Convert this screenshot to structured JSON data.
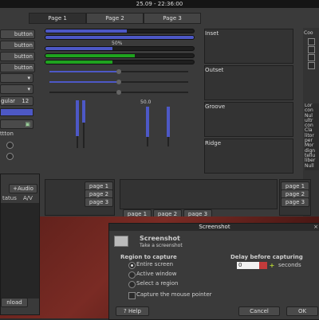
{
  "topbar": {
    "clock": "25.09 - 22:36:00"
  },
  "tabs": [
    "Page 1",
    "Page 2",
    "Page 3"
  ],
  "left_buttons": [
    "button",
    "button",
    "button",
    "button"
  ],
  "left_spin": {
    "value": "12",
    "label": "gular"
  },
  "left_text": {
    "label": "ttton"
  },
  "progress": {
    "percent_label": "50%",
    "blue_levels": [
      0.55,
      1.0,
      0.45
    ],
    "green_levels": [
      0.6,
      0.45
    ]
  },
  "frames": [
    "Inset",
    "Outset",
    "Groove",
    "Ridge"
  ],
  "scale_value": "50.0",
  "right_text": [
    "Lor",
    "con",
    "Nul",
    "ultr",
    "con",
    "Cla",
    "litor",
    "per",
    "Mor",
    "dign",
    "tellu",
    "liber",
    "Null"
  ],
  "right_col_label": "Coo",
  "notebook_left_tabs": [
    "page 1",
    "page 2",
    "page 3"
  ],
  "notebook_bottom_tabs": [
    "page 1",
    "page 2",
    "page 3"
  ],
  "notebook_right_tabs": [
    "page 1",
    "page 2",
    "page 3"
  ],
  "left_window": {
    "title": "+Audio",
    "col1": "tatus",
    "col2": "A/V",
    "button": "nload"
  },
  "dialog": {
    "title": "Screenshot",
    "heading": "Screenshot",
    "subheading": "Take a screenshot",
    "region_label": "Region to capture",
    "regions": [
      "Entire screen",
      "Active window",
      "Select a region"
    ],
    "capture_pointer": "Capture the mouse pointer",
    "delay_label": "Delay before capturing",
    "delay_value": "0",
    "delay_unit": "seconds",
    "help": "Help",
    "cancel": "Cancel",
    "ok": "OK"
  }
}
